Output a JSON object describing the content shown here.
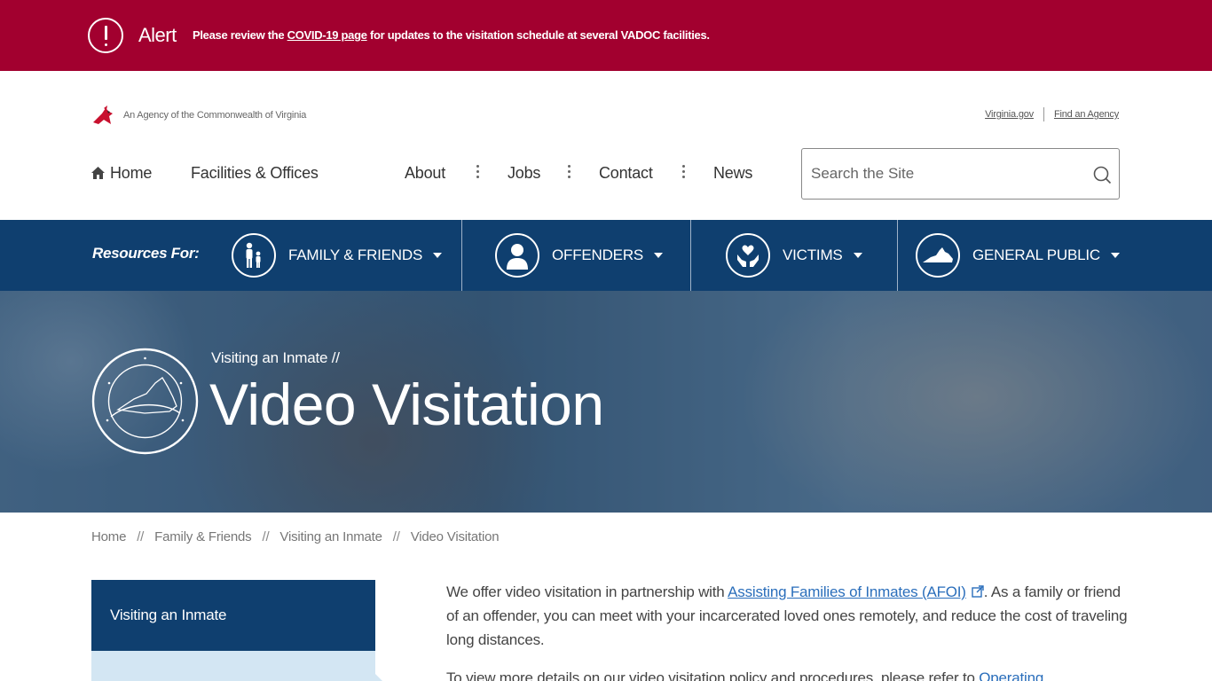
{
  "alert": {
    "title": "Alert",
    "msg_before": "Please review the ",
    "msg_link": "COVID-19 page",
    "msg_after": " for updates to the visitation schedule at several VADOC facilities."
  },
  "agency": {
    "tagline": "An Agency of the Commonwealth of Virginia",
    "link_virginia": "Virginia.gov",
    "link_find_agency": "Find an Agency"
  },
  "nav": {
    "home": "Home",
    "facilities": "Facilities & Offices",
    "about": "About",
    "jobs": "Jobs",
    "contact": "Contact",
    "news": "News"
  },
  "search": {
    "placeholder": "Search the Site"
  },
  "resources": {
    "label": "Resources For:",
    "items": [
      {
        "label": "Family & Friends",
        "icon": "family-icon"
      },
      {
        "label": "Offenders",
        "icon": "offender-icon"
      },
      {
        "label": "Victims",
        "icon": "heart-hands-icon"
      },
      {
        "label": "General Public",
        "icon": "virginia-map-icon"
      }
    ]
  },
  "hero": {
    "kicker": "Visiting an Inmate  //",
    "title": "Video Visitation"
  },
  "breadcrumb": {
    "items": [
      "Home",
      "Family & Friends",
      "Visiting an Inmate",
      "Video Visitation"
    ],
    "separator": "//"
  },
  "side_nav": {
    "heading": "Visiting an Inmate"
  },
  "content": {
    "p1_before": "We offer video visitation in partnership with ",
    "p1_link": "Assisting Families of Inmates (AFOI)",
    "p1_after": ". As a family or friend of an offender, you can meet with your incarcerated loved ones remotely, and reduce the cost of traveling long distances.",
    "p2_before": "To view more details on our video visitation policy and procedures, please refer to ",
    "p2_link": "Operating"
  },
  "colors": {
    "alert_bg": "#a2002f",
    "navy": "#0f3f6f",
    "link": "#2a6ebb",
    "side_sub_bg": "#d3e6f3"
  }
}
